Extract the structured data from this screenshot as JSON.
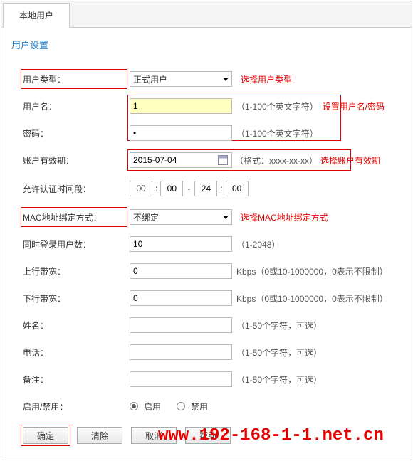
{
  "tab": {
    "label": "本地用户"
  },
  "section_title": "用户设置",
  "rows": {
    "user_type": {
      "label": "用户类型：",
      "value": "正式用户",
      "hint": "选择用户类型"
    },
    "username": {
      "label": "用户名：",
      "value": "1",
      "hint": "（1-100个英文字符）",
      "anno": "设置用户名/密码"
    },
    "password": {
      "label": "密码：",
      "value": "•",
      "hint": "（1-100个英文字符）"
    },
    "acct_expiry": {
      "label": "账户有效期：",
      "value": "2015-07-04",
      "hint": "（格式：xxxx-xx-xx）",
      "anno": "选择账户有效期"
    },
    "auth_time": {
      "label": "允许认证时间段：",
      "h1": "00",
      "m1": "00",
      "h2": "24",
      "m2": "00"
    },
    "mac_bind": {
      "label": "MAC地址绑定方式：",
      "value": "不绑定",
      "hint": "选择MAC地址绑定方式"
    },
    "concurrent": {
      "label": "同时登录用户数：",
      "value": "10",
      "hint": "（1-2048）"
    },
    "up_bw": {
      "label": "上行带宽：",
      "value": "0",
      "hint": "Kbps（0或10-1000000，0表示不限制）"
    },
    "down_bw": {
      "label": "下行带宽：",
      "value": "0",
      "hint": "Kbps（0或10-1000000，0表示不限制）"
    },
    "name": {
      "label": "姓名：",
      "value": "",
      "hint": "（1-50个字符，可选）"
    },
    "phone": {
      "label": "电话：",
      "value": "",
      "hint": "（1-50个字符，可选）"
    },
    "remark": {
      "label": "备注：",
      "value": "",
      "hint": "（1-50个字符，可选）"
    },
    "enable": {
      "label": "启用/禁用：",
      "opt1": "启用",
      "opt2": "禁用"
    }
  },
  "buttons": {
    "ok": "确定",
    "clear": "清除",
    "cancel": "取消",
    "help": "帮助"
  },
  "overlay_url": "www.192-168-1-1.net.cn"
}
